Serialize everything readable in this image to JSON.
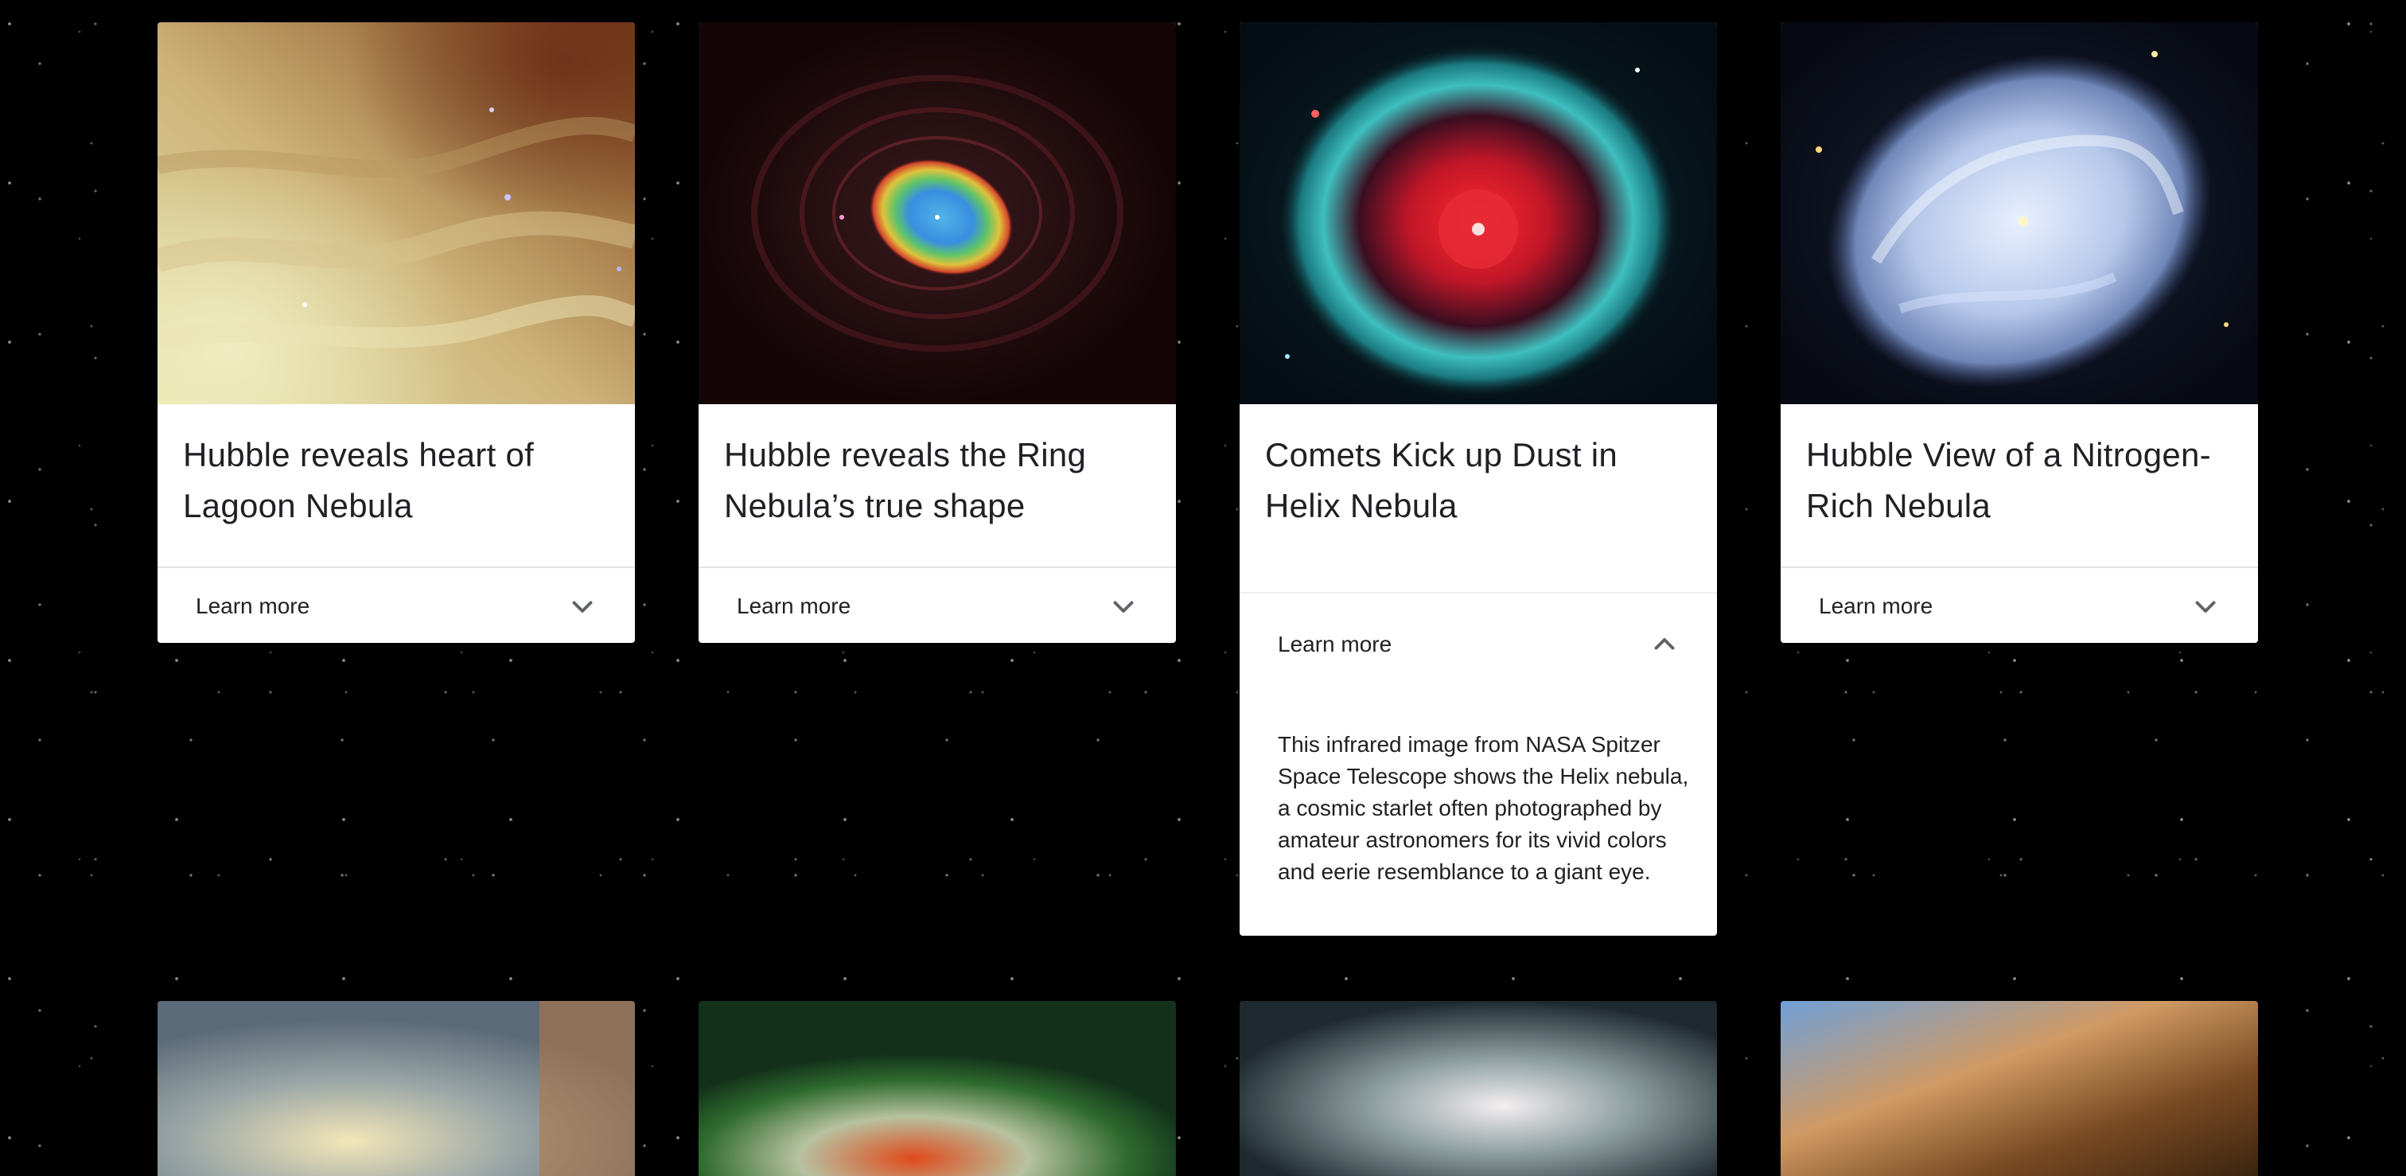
{
  "cards": [
    {
      "title": "Hubble reveals heart of Lagoon Nebula",
      "toggle_label": "Learn more",
      "expanded": false
    },
    {
      "title": "Hubble reveals the Ring Nebula’s true shape",
      "toggle_label": "Learn more",
      "expanded": false
    },
    {
      "title": "Comets Kick up Dust in Helix Nebula",
      "toggle_label": "Learn more",
      "expanded": true,
      "description": "This infrared image from NASA Spitzer Space Telescope shows the Helix nebula, a cosmic starlet often photographed by amateur astronomers for its vivid colors and eerie resemblance to a giant eye."
    },
    {
      "title": "Hubble View of a Nitrogen-Rich Nebula",
      "toggle_label": "Learn more",
      "expanded": false
    }
  ],
  "icons": {
    "collapsed": "chevron-down-icon",
    "expanded": "chevron-up-icon"
  },
  "colors": {
    "page_background": "#000000",
    "card_background": "#ffffff",
    "text": "#202124"
  }
}
